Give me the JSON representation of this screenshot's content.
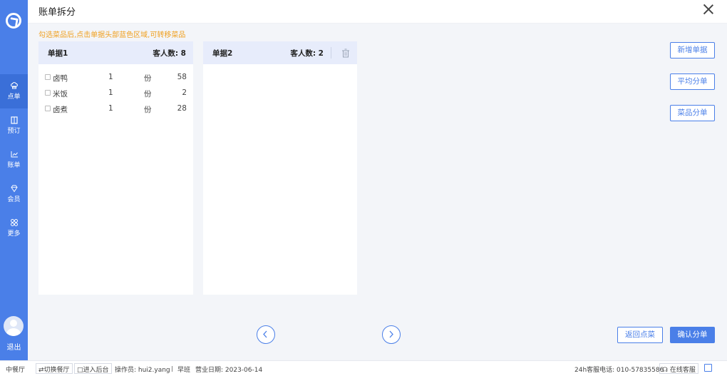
{
  "header": {
    "title": "账单拆分"
  },
  "hint": "勾选菜品后,点击单据头部蓝色区域,可转移菜品",
  "sidebar": {
    "items": [
      {
        "label": "点单",
        "icon": "chef-hat-icon"
      },
      {
        "label": "预订",
        "icon": "book-icon"
      },
      {
        "label": "账单",
        "icon": "chart-icon"
      },
      {
        "label": "会员",
        "icon": "diamond-icon"
      },
      {
        "label": "更多",
        "icon": "grid-icon"
      }
    ],
    "logout": "退出"
  },
  "bills": [
    {
      "name": "单据1",
      "guests": "客人数: 8",
      "items": [
        {
          "dish": "卤鸭",
          "qty": "1",
          "unit": "份",
          "price": "58"
        },
        {
          "dish": "米饭",
          "qty": "1",
          "unit": "份",
          "price": "2"
        },
        {
          "dish": "卤煮",
          "qty": "1",
          "unit": "份",
          "price": "28"
        }
      ]
    },
    {
      "name": "单据2",
      "guests": "客人数: 2",
      "items": []
    }
  ],
  "actions": {
    "add_bill": "新增单据",
    "average_split": "平均分单",
    "dish_split": "菜品分单",
    "back": "返回点菜",
    "confirm": "确认分单"
  },
  "statusbar": {
    "hall": "中餐厅",
    "switch_hall": "⇄切换餐厅",
    "enter_backend": "进入后台",
    "operator": "操作员: hui2.yang",
    "shift": "早班",
    "business_date": "营业日期: 2023-06-14",
    "hotline": "24h客服电话: 010-57835586",
    "online_service": "在线客服"
  },
  "colors": {
    "accent": "#4a7fe8",
    "hint": "#f0a020"
  }
}
